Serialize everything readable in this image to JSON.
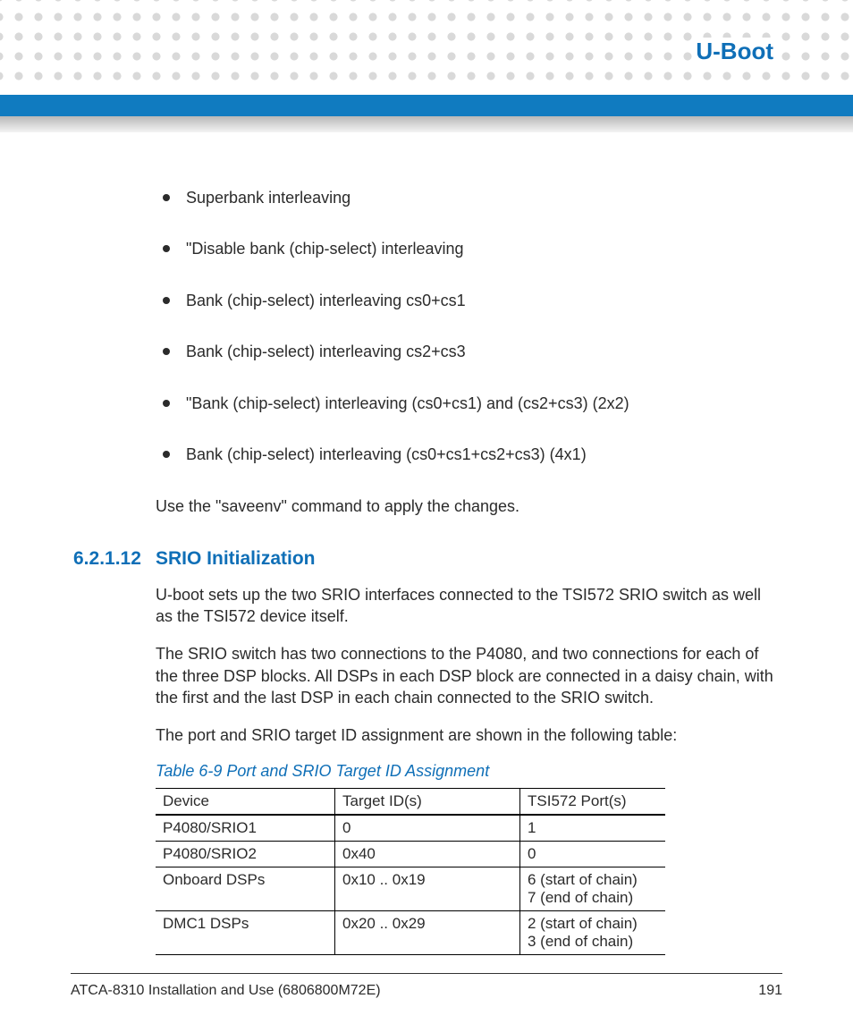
{
  "header": {
    "chapter": "U-Boot"
  },
  "bullets": [
    "Superbank interleaving",
    "\"Disable bank (chip-select) interleaving",
    "Bank (chip-select) interleaving cs0+cs1",
    "Bank (chip-select) interleaving cs2+cs3",
    "\"Bank (chip-select) interleaving (cs0+cs1) and (cs2+cs3) (2x2)",
    "Bank (chip-select) interleaving (cs0+cs1+cs2+cs3) (4x1)"
  ],
  "after_list": "Use the \"saveenv\" command to apply the changes.",
  "section": {
    "number": "6.2.1.12",
    "title": "SRIO Initialization",
    "p1": "U-boot sets up the two SRIO interfaces connected to the TSI572 SRIO switch as well as the TSI572 device itself.",
    "p2": "The SRIO switch has two connections to the P4080, and two connections for each of the three DSP blocks. All DSPs in each DSP block are connected in a daisy chain, with the first and the last DSP in each chain connected to the SRIO switch.",
    "p3": "The port and SRIO target ID assignment are shown in the following table:"
  },
  "table": {
    "caption": "Table 6-9 Port and SRIO Target ID Assignment",
    "headers": [
      "Device",
      "Target ID(s)",
      "TSI572 Port(s)"
    ],
    "rows": [
      [
        "P4080/SRIO1",
        "0",
        "1"
      ],
      [
        "P4080/SRIO2",
        "0x40",
        "0"
      ],
      [
        "Onboard DSPs",
        "0x10 .. 0x19",
        "6 (start of chain)\n7 (end of chain)"
      ],
      [
        "DMC1 DSPs",
        "0x20 .. 0x29",
        "2 (start of chain)\n3 (end of chain)"
      ]
    ]
  },
  "footer": {
    "doc": "ATCA-8310 Installation and Use (6806800M72E)",
    "page": "191"
  }
}
